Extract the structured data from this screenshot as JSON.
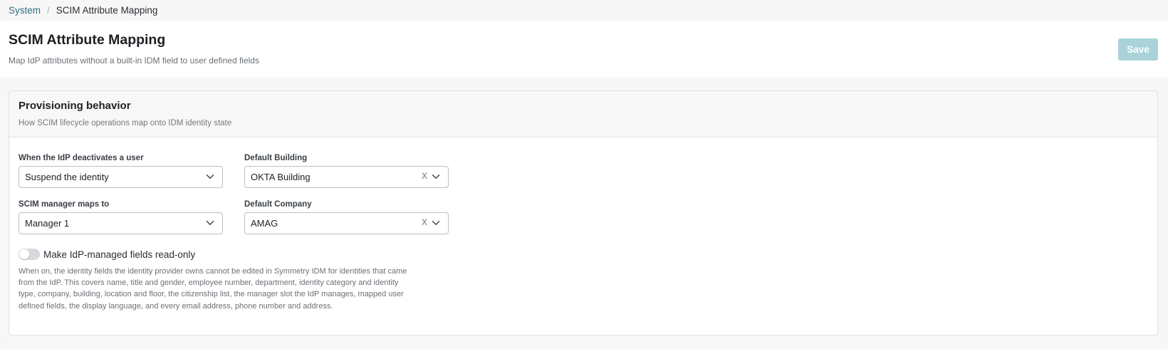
{
  "breadcrumb": {
    "parent": "System",
    "separator": "/",
    "current": "SCIM Attribute Mapping"
  },
  "header": {
    "title": "SCIM Attribute Mapping",
    "subtitle": "Map IdP attributes without a built-in IDM field to user defined fields",
    "save_label": "Save",
    "save_enabled": false
  },
  "card": {
    "title": "Provisioning behavior",
    "subtitle": "How SCIM lifecycle operations map onto IDM identity state",
    "fields": {
      "deactivate": {
        "label": "When the IdP deactivates a user",
        "value": "Suspend the identity"
      },
      "building": {
        "label": "Default Building",
        "value": "OKTA Building",
        "clearable": true
      },
      "manager": {
        "label": "SCIM manager maps to",
        "value": "Manager 1"
      },
      "company": {
        "label": "Default Company",
        "value": "AMAG",
        "clearable": true
      }
    },
    "readonly_toggle": {
      "label": "Make IdP-managed fields read-only",
      "on": false,
      "help": "When on, the identity fields the identity provider owns cannot be edited in Symmetry IDM for identities that came from the IdP. This covers name, title and gender, employee number, department, identity category and identity type, company, building, location and floor, the citizenship list, the manager slot the IdP manages, mapped user defined fields, the display language, and every email address, phone number and address."
    }
  },
  "icons": {
    "clear": "x-icon",
    "dropdown": "chevron-down-icon"
  },
  "colors": {
    "link": "#2e6f7e",
    "save_disabled": "#a9d2d9",
    "toggle_off": "#d7d9dc"
  }
}
